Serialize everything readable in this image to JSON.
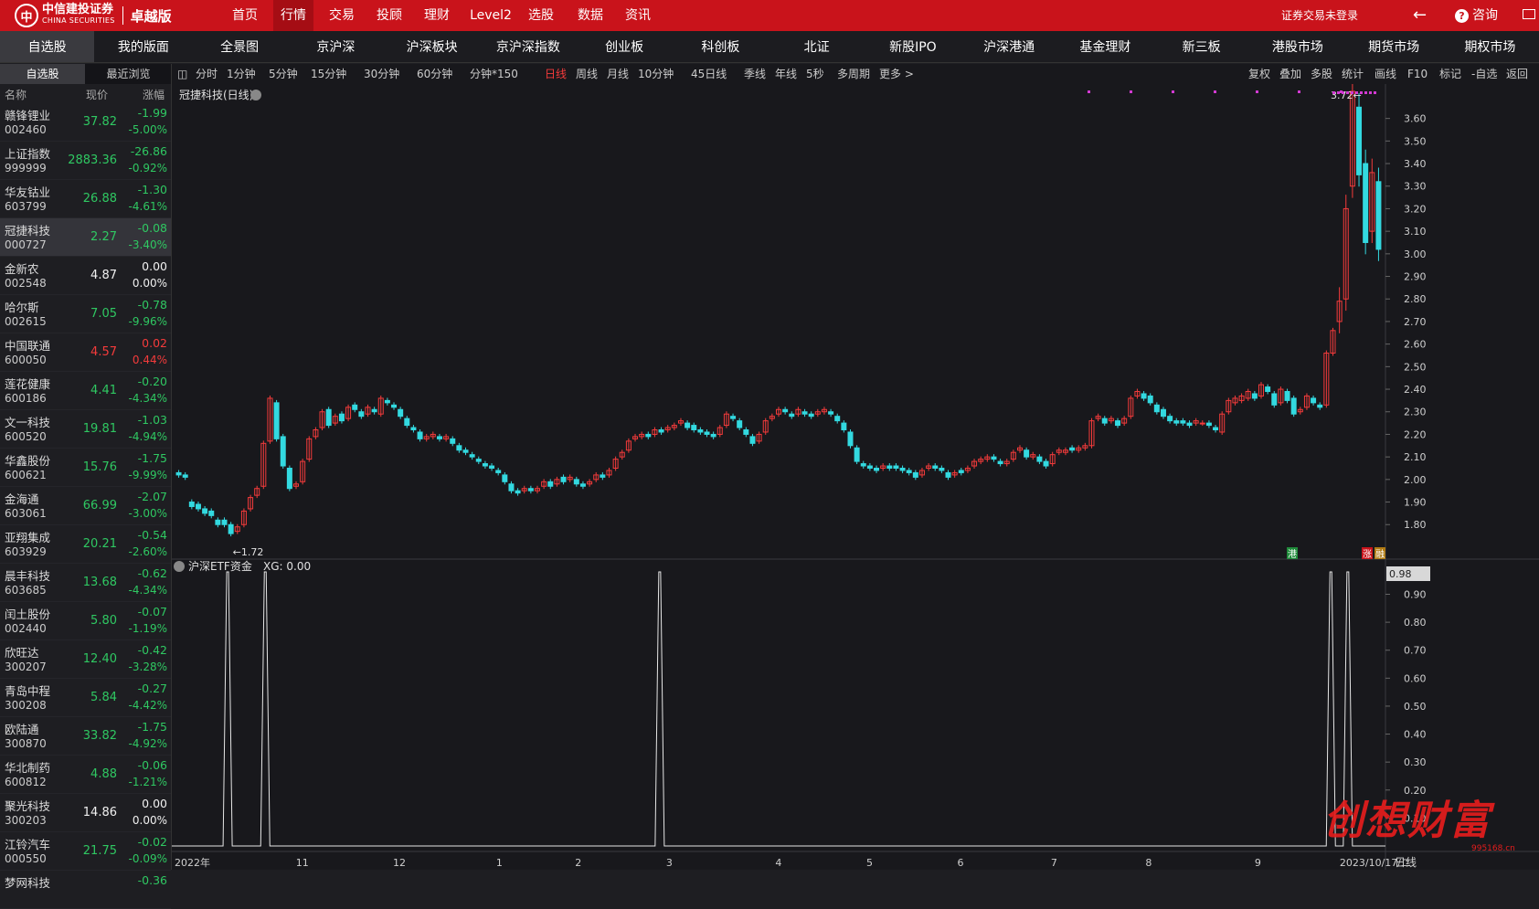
{
  "brand": {
    "cn_name": "中信建投证券",
    "en_name": "CHINA SECURITIES",
    "edition": "卓越版"
  },
  "topnav": [
    "首页",
    "行情",
    "交易",
    "投顾",
    "理财",
    "Level2",
    "选股",
    "数据",
    "资讯"
  ],
  "topnav_active": "行情",
  "login_status": "证券交易未登录",
  "consult_label": "咨询",
  "secnav": [
    "自选股",
    "我的版面",
    "全景图",
    "京沪深",
    "沪深板块",
    "京沪深指数",
    "创业板",
    "科创板",
    "北证",
    "新股IPO",
    "沪深港通",
    "基金理财",
    "新三板",
    "港股市场",
    "期货市场",
    "期权市场"
  ],
  "left_tabs": [
    "自选股",
    "最近浏览"
  ],
  "list_headers": {
    "name": "名称",
    "price": "现价",
    "change": "涨幅"
  },
  "stocks": [
    {
      "name": "赣锋锂业",
      "code": "002460",
      "price": "37.82",
      "change": "-1.99",
      "pct": "-5.00%",
      "dir": "g"
    },
    {
      "name": "上证指数",
      "code": "999999",
      "price": "2883.36",
      "change": "-26.86",
      "pct": "-0.92%",
      "dir": "g"
    },
    {
      "name": "华友钴业",
      "code": "603799",
      "price": "26.88",
      "change": "-1.30",
      "pct": "-4.61%",
      "dir": "g"
    },
    {
      "name": "冠捷科技",
      "code": "000727",
      "price": "2.27",
      "change": "-0.08",
      "pct": "-3.40%",
      "dir": "g",
      "selected": true
    },
    {
      "name": "金新农",
      "code": "002548",
      "price": "4.87",
      "change": "0.00",
      "pct": "0.00%",
      "dir": "w"
    },
    {
      "name": "哈尔斯",
      "code": "002615",
      "price": "7.05",
      "change": "-0.78",
      "pct": "-9.96%",
      "dir": "g"
    },
    {
      "name": "中国联通",
      "code": "600050",
      "price": "4.57",
      "change": "0.02",
      "pct": "0.44%",
      "dir": "r"
    },
    {
      "name": "莲花健康",
      "code": "600186",
      "price": "4.41",
      "change": "-0.20",
      "pct": "-4.34%",
      "dir": "g"
    },
    {
      "name": "文一科技",
      "code": "600520",
      "price": "19.81",
      "change": "-1.03",
      "pct": "-4.94%",
      "dir": "g"
    },
    {
      "name": "华鑫股份",
      "code": "600621",
      "price": "15.76",
      "change": "-1.75",
      "pct": "-9.99%",
      "dir": "g"
    },
    {
      "name": "金海通",
      "code": "603061",
      "price": "66.99",
      "change": "-2.07",
      "pct": "-3.00%",
      "dir": "g"
    },
    {
      "name": "亚翔集成",
      "code": "603929",
      "price": "20.21",
      "change": "-0.54",
      "pct": "-2.60%",
      "dir": "g"
    },
    {
      "name": "晨丰科技",
      "code": "603685",
      "price": "13.68",
      "change": "-0.62",
      "pct": "-4.34%",
      "dir": "g"
    },
    {
      "name": "闰土股份",
      "code": "002440",
      "price": "5.80",
      "change": "-0.07",
      "pct": "-1.19%",
      "dir": "g"
    },
    {
      "name": "欣旺达",
      "code": "300207",
      "price": "12.40",
      "change": "-0.42",
      "pct": "-3.28%",
      "dir": "g"
    },
    {
      "name": "青岛中程",
      "code": "300208",
      "price": "5.84",
      "change": "-0.27",
      "pct": "-4.42%",
      "dir": "g"
    },
    {
      "name": "欧陆通",
      "code": "300870",
      "price": "33.82",
      "change": "-1.75",
      "pct": "-4.92%",
      "dir": "g"
    },
    {
      "name": "华北制药",
      "code": "600812",
      "price": "4.88",
      "change": "-0.06",
      "pct": "-1.21%",
      "dir": "g"
    },
    {
      "name": "聚光科技",
      "code": "300203",
      "price": "14.86",
      "change": "0.00",
      "pct": "0.00%",
      "dir": "w"
    },
    {
      "name": "江铃汽车",
      "code": "000550",
      "price": "21.75",
      "change": "-0.02",
      "pct": "-0.09%",
      "dir": "g"
    },
    {
      "name": "梦网科技",
      "code": "",
      "price": "",
      "change": "-0.36",
      "pct": "",
      "dir": "g"
    }
  ],
  "period_tabs": [
    "分时",
    "1分钟",
    "5分钟",
    "15分钟",
    "30分钟",
    "60分钟",
    "分钟*150",
    "日线",
    "周线",
    "月线",
    "10分钟",
    "45日线",
    "季线",
    "年线",
    "5秒",
    "多周期",
    "更多 >"
  ],
  "period_active": "日线",
  "right_tools": [
    "复权",
    "叠加",
    "多股",
    "统计",
    "画线",
    "F10",
    "标记",
    "-自选",
    "返回"
  ],
  "chart_data": [
    {
      "type": "candlestick",
      "title": "冠捷科技(日线)",
      "y_ticks": [
        "3.60",
        "3.50",
        "3.40",
        "3.30",
        "3.20",
        "3.10",
        "3.00",
        "2.90",
        "2.80",
        "2.70",
        "2.60",
        "2.50",
        "2.40",
        "2.30",
        "2.20",
        "2.10",
        "2.00",
        "1.90",
        "1.80"
      ],
      "ylim": [
        1.72,
        3.72
      ],
      "x_ticks": [
        "2022年",
        "11",
        "12",
        "1",
        "2",
        "3",
        "4",
        "5",
        "6",
        "7",
        "8",
        "9",
        "2023/10/17/二"
      ],
      "x_tick_pos": [
        0,
        0.1,
        0.18,
        0.265,
        0.33,
        0.405,
        0.495,
        0.57,
        0.645,
        0.722,
        0.8,
        0.89,
        0.96
      ],
      "annotation_low": "1.72",
      "annotation_high": "3.72",
      "marker_gang": "港",
      "marker_zhang": "涨",
      "marker_rong": "融",
      "close_series": [
        2.02,
        2.01,
        1.88,
        1.87,
        1.85,
        1.84,
        1.8,
        1.8,
        1.76,
        1.79,
        1.86,
        1.92,
        1.96,
        2.16,
        2.36,
        2.18,
        2.06,
        1.96,
        1.98,
        2.08,
        2.18,
        2.22,
        2.3,
        2.24,
        2.28,
        2.26,
        2.32,
        2.31,
        2.28,
        2.32,
        2.3,
        2.36,
        2.34,
        2.32,
        2.28,
        2.24,
        2.22,
        2.18,
        2.19,
        2.2,
        2.18,
        2.19,
        2.16,
        2.13,
        2.12,
        2.1,
        2.08,
        2.06,
        2.05,
        2.03,
        1.99,
        1.95,
        1.94,
        1.96,
        1.95,
        1.96,
        1.99,
        1.97,
        2.0,
        1.99,
        2.01,
        1.98,
        1.97,
        1.99,
        2.02,
        2.01,
        2.04,
        2.09,
        2.12,
        2.17,
        2.19,
        2.2,
        2.19,
        2.22,
        2.21,
        2.23,
        2.24,
        2.26,
        2.23,
        2.22,
        2.21,
        2.2,
        2.19,
        2.23,
        2.29,
        2.27,
        2.23,
        2.2,
        2.16,
        2.2,
        2.26,
        2.28,
        2.31,
        2.3,
        2.28,
        2.31,
        2.29,
        2.28,
        2.3,
        2.31,
        2.29,
        2.26,
        2.22,
        2.15,
        2.08,
        2.06,
        2.05,
        2.04,
        2.06,
        2.05,
        2.05,
        2.04,
        2.03,
        2.01,
        2.04,
        2.06,
        2.05,
        2.04,
        2.01,
        2.03,
        2.03,
        2.05,
        2.08,
        2.09,
        2.1,
        2.09,
        2.07,
        2.08,
        2.12,
        2.14,
        2.1,
        2.11,
        2.08,
        2.06,
        2.11,
        2.13,
        2.13,
        2.13,
        2.14,
        2.15,
        2.26,
        2.28,
        2.25,
        2.27,
        2.24,
        2.27,
        2.36,
        2.39,
        2.36,
        2.34,
        2.3,
        2.28,
        2.26,
        2.25,
        2.25,
        2.24,
        2.26,
        2.25,
        2.24,
        2.22,
        2.29,
        2.35,
        2.36,
        2.37,
        2.39,
        2.36,
        2.42,
        2.39,
        2.33,
        2.4,
        2.35,
        2.29,
        2.31,
        2.37,
        2.34,
        2.32,
        2.56,
        2.66,
        2.79,
        3.2,
        3.72,
        3.35,
        3.05,
        3.36,
        3.02
      ],
      "open_series": [
        2.03,
        2.02,
        1.9,
        1.89,
        1.87,
        1.86,
        1.82,
        1.82,
        1.8,
        1.77,
        1.8,
        1.87,
        1.93,
        1.97,
        2.17,
        2.34,
        2.19,
        2.05,
        1.97,
        1.99,
        2.09,
        2.19,
        2.23,
        2.31,
        2.25,
        2.29,
        2.27,
        2.33,
        2.3,
        2.29,
        2.31,
        2.29,
        2.35,
        2.33,
        2.31,
        2.27,
        2.23,
        2.21,
        2.18,
        2.19,
        2.19,
        2.18,
        2.18,
        2.15,
        2.13,
        2.11,
        2.09,
        2.07,
        2.06,
        2.04,
        2.02,
        1.98,
        1.95,
        1.95,
        1.96,
        1.95,
        1.97,
        1.99,
        1.98,
        2.01,
        2.0,
        2.0,
        1.98,
        1.98,
        2.0,
        2.02,
        2.02,
        2.05,
        2.1,
        2.13,
        2.18,
        2.19,
        2.2,
        2.2,
        2.22,
        2.22,
        2.23,
        2.25,
        2.25,
        2.24,
        2.22,
        2.21,
        2.2,
        2.2,
        2.24,
        2.28,
        2.26,
        2.22,
        2.19,
        2.17,
        2.21,
        2.27,
        2.29,
        2.31,
        2.29,
        2.29,
        2.3,
        2.29,
        2.29,
        2.3,
        2.3,
        2.28,
        2.25,
        2.21,
        2.14,
        2.07,
        2.06,
        2.05,
        2.05,
        2.06,
        2.06,
        2.05,
        2.04,
        2.03,
        2.02,
        2.05,
        2.06,
        2.05,
        2.03,
        2.02,
        2.04,
        2.04,
        2.06,
        2.08,
        2.09,
        2.1,
        2.08,
        2.07,
        2.09,
        2.13,
        2.13,
        2.1,
        2.1,
        2.08,
        2.07,
        2.12,
        2.12,
        2.14,
        2.13,
        2.14,
        2.15,
        2.27,
        2.27,
        2.26,
        2.26,
        2.25,
        2.28,
        2.37,
        2.38,
        2.37,
        2.33,
        2.31,
        2.28,
        2.26,
        2.26,
        2.25,
        2.25,
        2.25,
        2.25,
        2.23,
        2.21,
        2.3,
        2.34,
        2.35,
        2.36,
        2.38,
        2.37,
        2.41,
        2.38,
        2.34,
        2.39,
        2.36,
        2.3,
        2.32,
        2.36,
        2.33,
        2.33,
        2.56,
        2.7,
        2.8,
        3.3,
        3.65,
        3.4,
        3.1,
        3.32
      ]
    },
    {
      "type": "line",
      "title": "沪深ETF资金",
      "xg_label": "XG: 0.00",
      "y_ticks": [
        "0.90",
        "0.80",
        "0.70",
        "0.60",
        "0.50",
        "0.40",
        "0.30",
        "0.20",
        "0.10"
      ],
      "ymax_label": "0.98",
      "ylim": [
        0,
        0.98
      ],
      "spike_fractions": [
        0.046,
        0.077,
        0.402,
        0.955,
        0.969
      ],
      "period_label": "日线"
    }
  ],
  "watermark": "创想财富",
  "watermark_url": "995168.cn",
  "colors": {
    "up": "#f43b3b",
    "down": "#33d9e0",
    "accent": "#c9131b"
  }
}
